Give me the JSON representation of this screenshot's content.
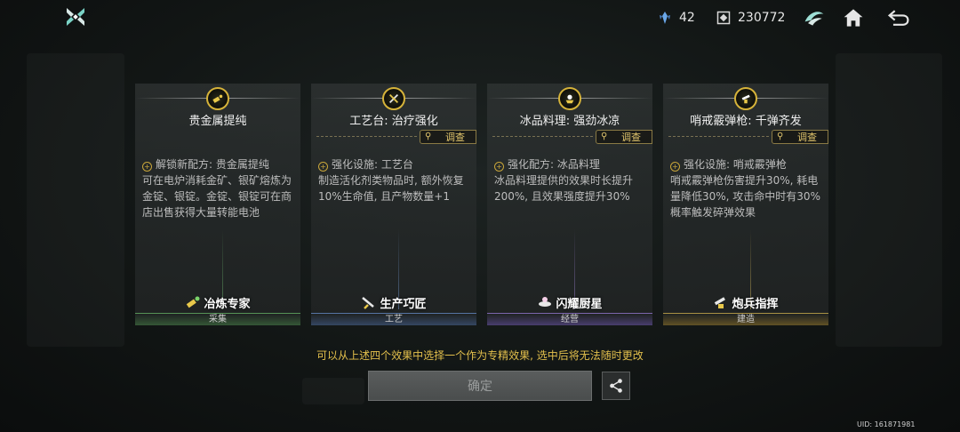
{
  "top_bar": {
    "logo_icon": "guild-emblem-icon",
    "energy": {
      "icon": "energy-crystal-icon",
      "value": "42"
    },
    "coins": {
      "icon": "currency-icon",
      "value": "230772"
    },
    "buttons": [
      {
        "name": "guild-icon"
      },
      {
        "name": "home-icon"
      },
      {
        "name": "back-icon"
      }
    ]
  },
  "cards": [
    {
      "title": "贵金属提纯",
      "inspect_label": "",
      "body": "解锁新配方: 贵金属提纯\n可在电炉消耗金矿、银矿熔炼为金锭、银锭。金锭、银锭可在商店出售获得大量转能电池",
      "badge": "冶炼专家",
      "category": "采集",
      "accent": "#4f8f4f"
    },
    {
      "title": "工艺台: 治疗强化",
      "inspect_label": "调查",
      "body": "强化设施: 工艺台\n制造活化剂类物品时, 额外恢复10%生命值, 且产物数量+1",
      "badge": "生产巧匠",
      "category": "工艺",
      "accent": "#5a78a8"
    },
    {
      "title": "冰品料理: 强劲冰凉",
      "inspect_label": "调查",
      "body": "强化配方: 冰品料理\n冰品料理提供的效果时长提升200%, 且效果强度提升30%",
      "badge": "闪耀厨星",
      "category": "经营",
      "accent": "#7a62b4"
    },
    {
      "title": "哨戒霰弹枪: 千弹齐发",
      "inspect_label": "调查",
      "body": "强化设施: 哨戒霰弹枪\n哨戒霰弹枪伤害提升30%, 耗电量降低30%, 攻击命中时有30%概率触发碎弹效果",
      "badge": "炮兵指挥",
      "category": "建造",
      "accent": "#b8952f"
    }
  ],
  "hint": "可以从上述四个效果中选择一个作为专精效果, 选中后将无法随时更改",
  "confirm_label": "确定",
  "share_icon": "share-icon",
  "uid": "UID: 161871981"
}
